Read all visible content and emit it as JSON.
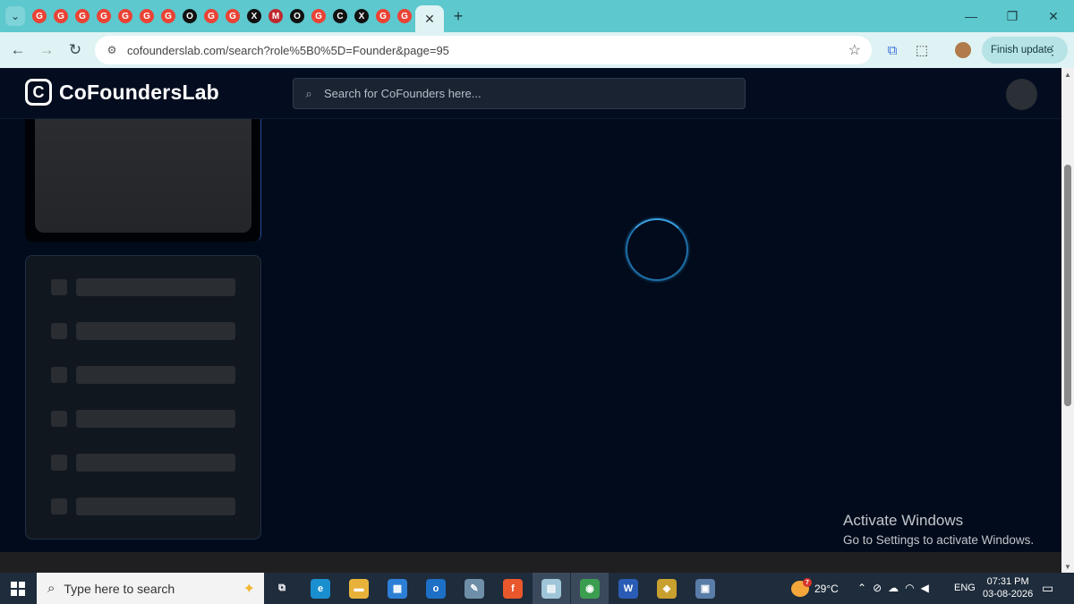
{
  "browser": {
    "tabs": [
      {
        "icon": "g",
        "color": "#ea4335"
      },
      {
        "icon": "g",
        "color": "#ea4335"
      },
      {
        "icon": "g",
        "color": "#ea4335"
      },
      {
        "icon": "g",
        "color": "#ea4335"
      },
      {
        "icon": "g",
        "color": "#ea4335"
      },
      {
        "icon": "g",
        "color": "#ea4335"
      },
      {
        "icon": "g",
        "color": "#ea4335"
      },
      {
        "icon": "o",
        "color": "#111111"
      },
      {
        "icon": "g",
        "color": "#ea4335"
      },
      {
        "icon": "g",
        "color": "#ea4335"
      },
      {
        "icon": "x",
        "color": "#111111"
      },
      {
        "icon": "m",
        "color": "#c0282d"
      },
      {
        "icon": "o",
        "color": "#111111"
      },
      {
        "icon": "g",
        "color": "#ea4335"
      },
      {
        "icon": "c",
        "color": "#111111"
      },
      {
        "icon": "x",
        "color": "#111111"
      },
      {
        "icon": "g",
        "color": "#ea4335"
      },
      {
        "icon": "g",
        "color": "#ea4335"
      }
    ],
    "active_tab_close": "✕",
    "new_tab": "+",
    "url": "cofounderslab.com/search?role%5B0%5D=Founder&page=95",
    "finish_update_label": "Finish update"
  },
  "site": {
    "logo_text": "CoFoundersLab",
    "search_placeholder": "Search for CoFounders here..."
  },
  "filters": {
    "skeleton_rows": 6
  },
  "watermark": {
    "title": "Activate Windows",
    "subtitle": "Go to Settings to activate Windows."
  },
  "taskbar": {
    "search_placeholder": "Type here to search",
    "apps": [
      {
        "name": "task-view",
        "glyph": "⧉",
        "color": "#1e2c3c"
      },
      {
        "name": "edge",
        "glyph": "e",
        "color": "#1a8fd0"
      },
      {
        "name": "file-explorer",
        "glyph": "▬",
        "color": "#e8b23a"
      },
      {
        "name": "store",
        "glyph": "▦",
        "color": "#2d7fd6"
      },
      {
        "name": "outlook",
        "glyph": "o",
        "color": "#1e6fc6"
      },
      {
        "name": "paint",
        "glyph": "✎",
        "color": "#6f8fa8"
      },
      {
        "name": "firefox",
        "glyph": "f",
        "color": "#e9572c"
      },
      {
        "name": "notes",
        "glyph": "▤",
        "color": "#9fc6d8"
      },
      {
        "name": "chrome",
        "glyph": "◉",
        "color": "#3a9d4f"
      },
      {
        "name": "word",
        "glyph": "W",
        "color": "#2b5cb5"
      },
      {
        "name": "vpn",
        "glyph": "◈",
        "color": "#c8a030"
      },
      {
        "name": "remote",
        "glyph": "▣",
        "color": "#5a7da8"
      }
    ],
    "weather_temp": "29°C",
    "weather_badge": "7",
    "language": "ENG",
    "time": "07:31 PM",
    "date": "03-08-2026"
  }
}
